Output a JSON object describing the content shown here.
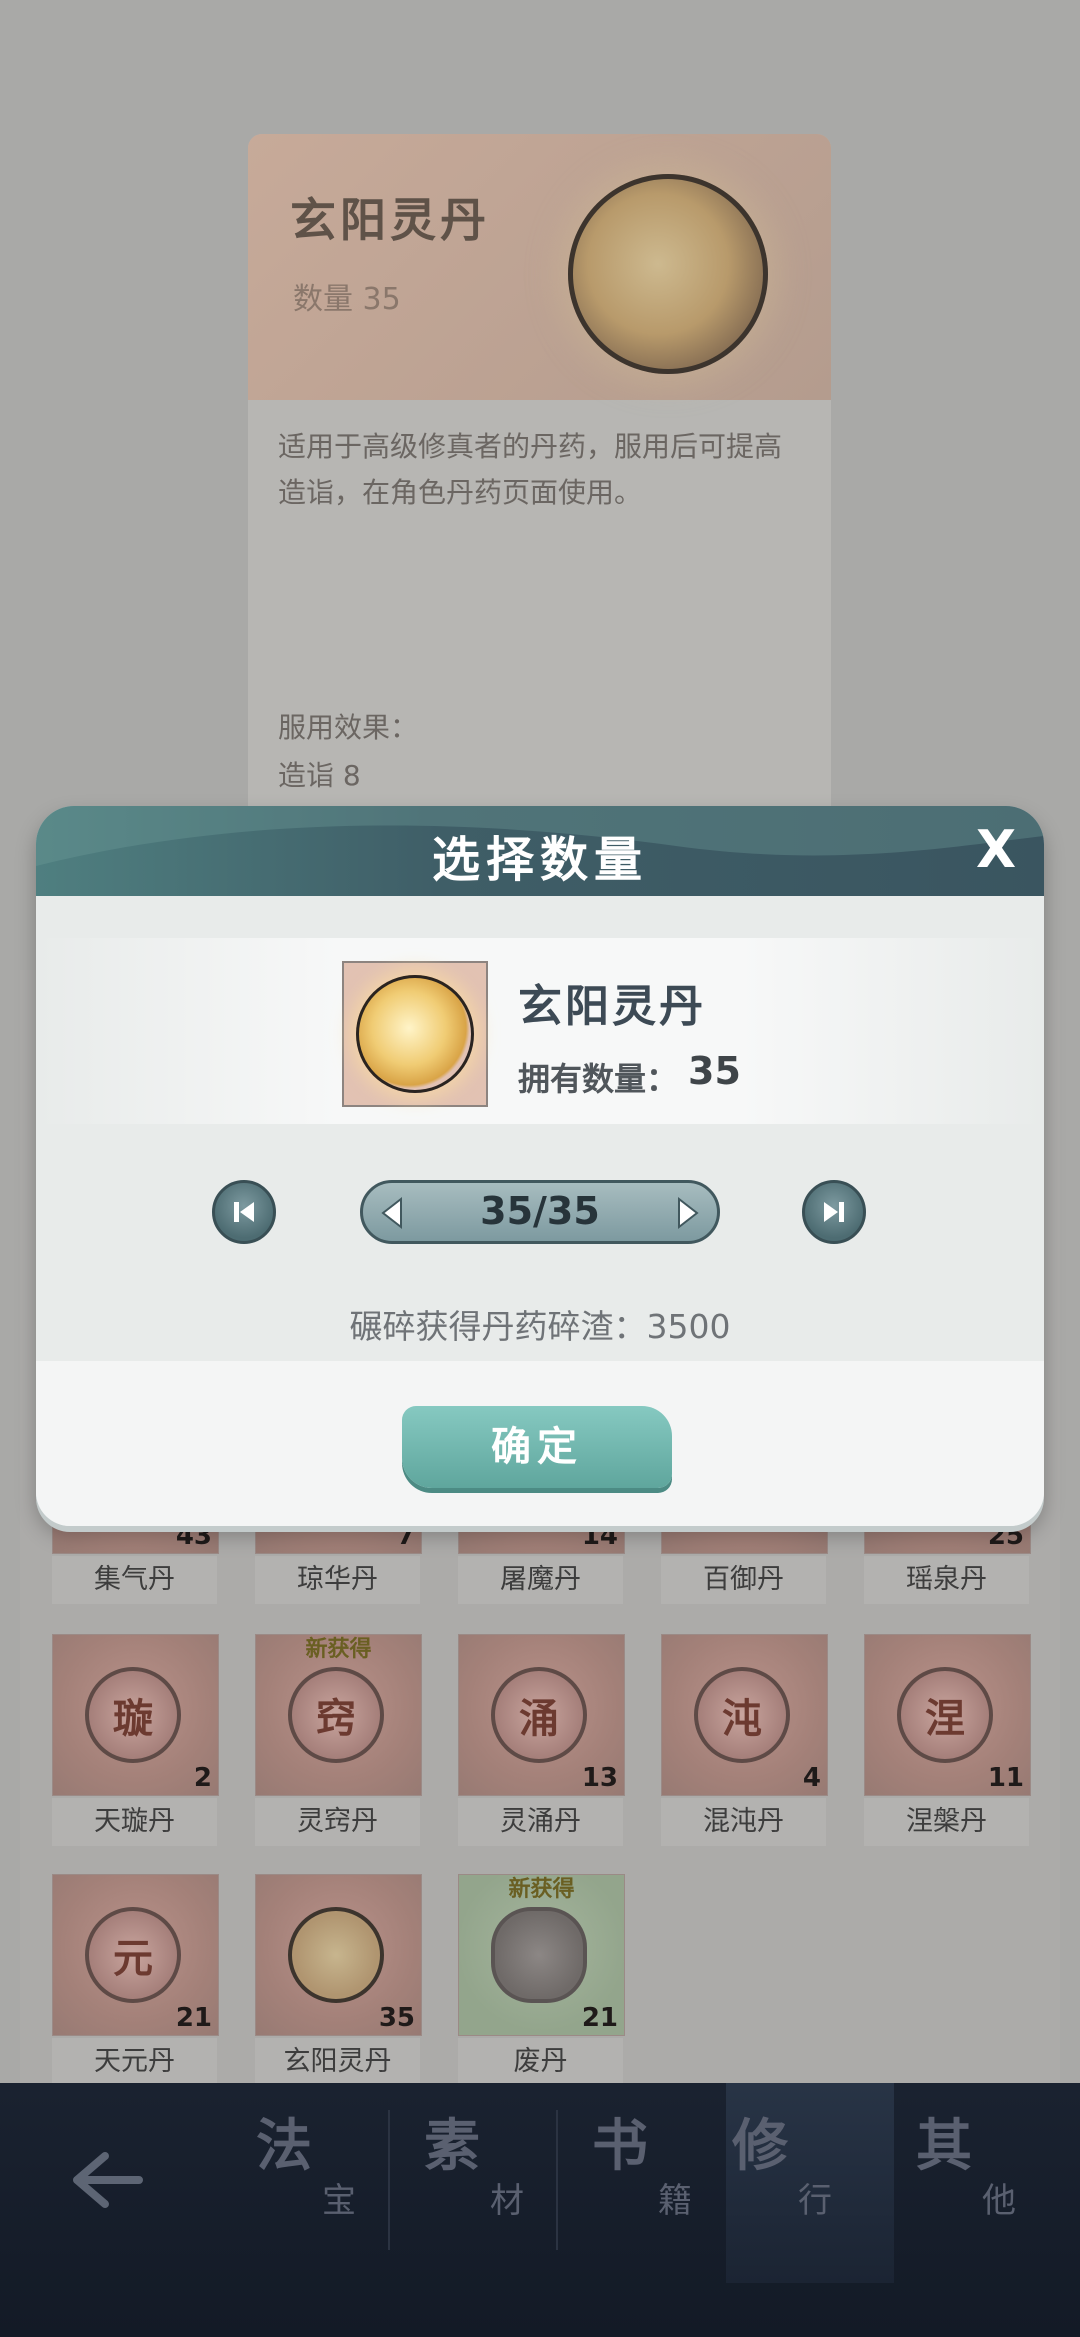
{
  "detail": {
    "name": "玄阳灵丹",
    "count_text": "数量 35",
    "description": "适用于高级修真者的丹药，服用后可提高造诣，在角色丹药页面使用。",
    "effect_label": "服用效果：",
    "effect_value": "造诣 8"
  },
  "grid": {
    "row1": [
      {
        "name": "集气丹",
        "count": "43"
      },
      {
        "name": "琼华丹",
        "count": "7"
      },
      {
        "name": "屠魔丹",
        "count": "14"
      },
      {
        "name": "百御丹",
        "count": ""
      },
      {
        "name": "瑶泉丹",
        "count": "25"
      }
    ],
    "row2": [
      {
        "name": "天璇丹",
        "count": "2",
        "emblem": "璇",
        "new": ""
      },
      {
        "name": "灵窍丹",
        "count": "",
        "emblem": "窍",
        "new": "新获得"
      },
      {
        "name": "灵涌丹",
        "count": "13",
        "emblem": "涌",
        "new": ""
      },
      {
        "name": "混沌丹",
        "count": "4",
        "emblem": "沌",
        "new": ""
      },
      {
        "name": "涅槃丹",
        "count": "11",
        "emblem": "涅",
        "new": ""
      }
    ],
    "row3": [
      {
        "name": "天元丹",
        "count": "21",
        "emblem": "元",
        "new": ""
      },
      {
        "name": "玄阳灵丹",
        "count": "35",
        "emblem": "",
        "new": ""
      },
      {
        "name": "废丹",
        "count": "21",
        "emblem": "",
        "new": "新获得"
      }
    ]
  },
  "tabs": [
    {
      "big": "法",
      "small": "宝"
    },
    {
      "big": "素",
      "small": "材"
    },
    {
      "big": "书",
      "small": "籍"
    },
    {
      "big": "修",
      "small": "行"
    },
    {
      "big": "其",
      "small": "他"
    }
  ],
  "modal": {
    "title": "选择数量",
    "close": "X",
    "item_name": "玄阳灵丹",
    "owned_label": "拥有数量：",
    "owned_value": "35",
    "quantity": "35/35",
    "result_text": "碾碎获得丹药碎渣：3500",
    "confirm": "确定"
  }
}
